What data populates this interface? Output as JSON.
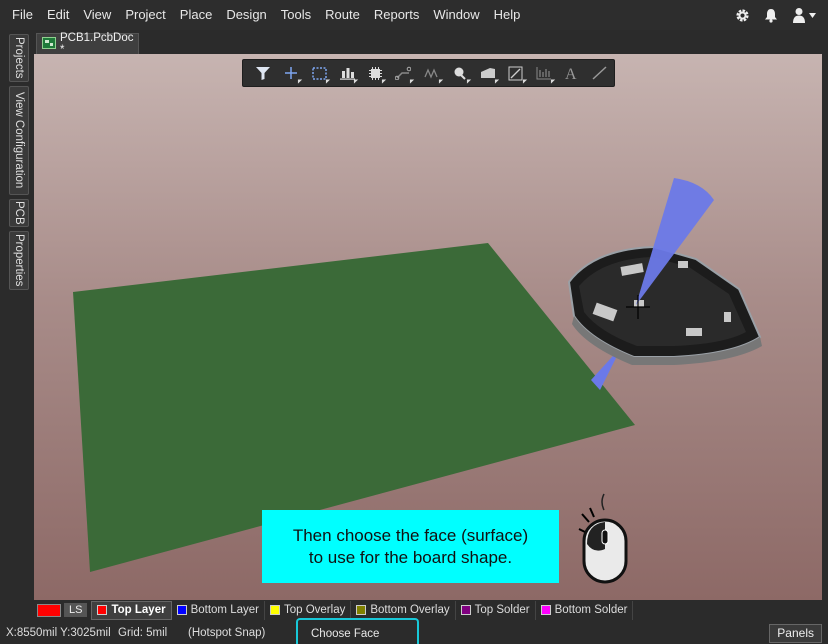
{
  "menu": {
    "items": [
      "File",
      "Edit",
      "View",
      "Project",
      "Place",
      "Design",
      "Tools",
      "Route",
      "Reports",
      "Window",
      "Help"
    ],
    "right_icons": [
      "gear-icon",
      "bell-icon",
      "user-icon"
    ]
  },
  "side_panels": [
    "Projects",
    "View Configuration",
    "PCB",
    "Properties"
  ],
  "document_tab": {
    "label": "PCB1.PcbDoc *"
  },
  "view_toolbar": {
    "tools": [
      "filter-icon",
      "add-icon",
      "select-rect-icon",
      "align-icon",
      "component-icon",
      "route-icon",
      "interactive-route-icon",
      "via-icon",
      "polygon-icon",
      "dimension-icon",
      "chart-icon",
      "text-icon",
      "line-icon"
    ]
  },
  "callout": {
    "line1": "Then choose the face (surface)",
    "line2": "to use for the board shape."
  },
  "layers": {
    "ls_label": "LS",
    "ls_color": "#ff0000",
    "tabs": [
      {
        "label": "Top Layer",
        "color": "#ff0000",
        "active": true
      },
      {
        "label": "Bottom Layer",
        "color": "#0000ff",
        "active": false
      },
      {
        "label": "Top Overlay",
        "color": "#ffff00",
        "active": false
      },
      {
        "label": "Bottom Overlay",
        "color": "#808000",
        "active": false
      },
      {
        "label": "Top Solder",
        "color": "#800080",
        "active": false
      },
      {
        "label": "Bottom Solder",
        "color": "#ff00ff",
        "active": false
      }
    ]
  },
  "status": {
    "coords": "X:8550mil Y:3025mil",
    "grid": "Grid: 5mil",
    "snap": "(Hotspot Snap)",
    "mode": "Choose Face",
    "panels_button": "Panels"
  },
  "colors": {
    "board_green": "#3b6a38",
    "callout_bg": "#00ffff",
    "highlight_border": "#18c8d8"
  }
}
